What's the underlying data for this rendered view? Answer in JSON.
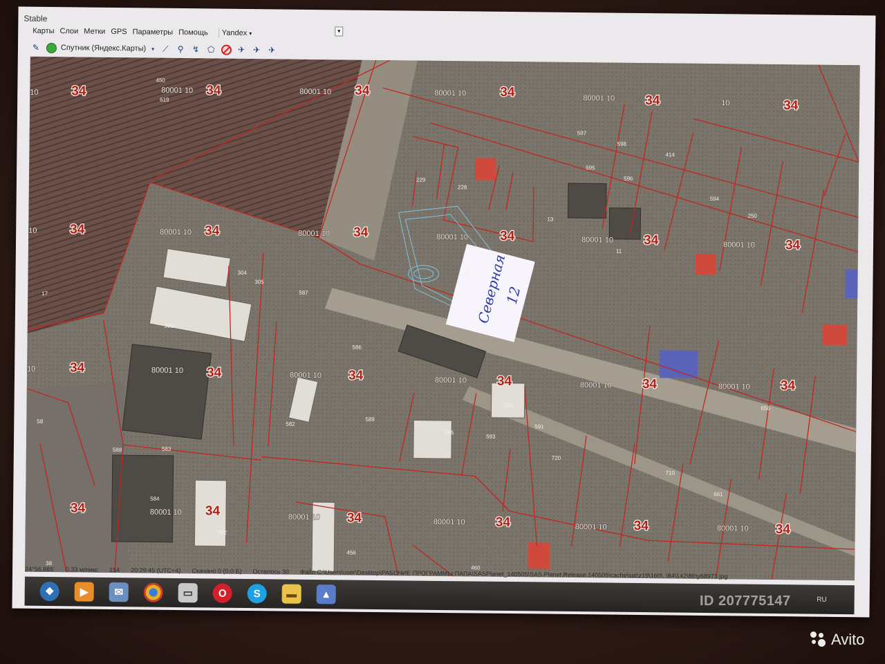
{
  "window": {
    "title": "Stable"
  },
  "menu": {
    "items": [
      "Карты",
      "Слои",
      "Метки",
      "GPS",
      "Параметры",
      "Помощь"
    ],
    "map_source": "Yandex",
    "caret": "▾"
  },
  "toolbar": {
    "layer_label": "Спутник (Яндекс.Карты)"
  },
  "map": {
    "handwritten_text": "Северная",
    "handwritten_number": "12",
    "parcel_labels": [
      {
        "big": "34",
        "small": "10"
      },
      {
        "big": "34",
        "small": "80001 10"
      }
    ],
    "big_label": "34",
    "small_labels": [
      "80001 10",
      "80001 10",
      "80001 10",
      "10",
      "10"
    ],
    "plot_numbers": [
      "450",
      "619",
      "304",
      "305",
      "587",
      "303",
      "586",
      "582",
      "588",
      "583",
      "584",
      "589",
      "590",
      "591",
      "592",
      "593",
      "585",
      "597",
      "598",
      "414",
      "594",
      "250",
      "595",
      "596",
      "229",
      "228",
      "13",
      "148",
      "11",
      "656",
      "661",
      "710",
      "720",
      "460",
      "456",
      "17",
      "58",
      "38"
    ]
  },
  "status": {
    "coords": "24°56.865'",
    "scale": "0.33 м/пикс",
    "zoom": "154",
    "time": "20:29:45 (UTC+4)",
    "downloaded": "Скачано 0 (0,0 Б)",
    "remaining": "Осталось 30",
    "file": "Файл C:\\Users\\user\\Desktop\\РАБОЧИЕ ПРОГРАММЫ ПАПА\\SASPlanet_140505\\SAS.Planet.Release.140505\\cache\\sat\\z19\\160\\..\\84\\142\\86\\y68973.jpg"
  },
  "taskbar": {
    "apps": [
      "windows",
      "media",
      "mail",
      "chrome",
      "window",
      "opera",
      "skype",
      "folder",
      "sas"
    ],
    "lang": "RU"
  },
  "watermark": {
    "id_text": "ID 207775147",
    "brand": "Avito"
  }
}
